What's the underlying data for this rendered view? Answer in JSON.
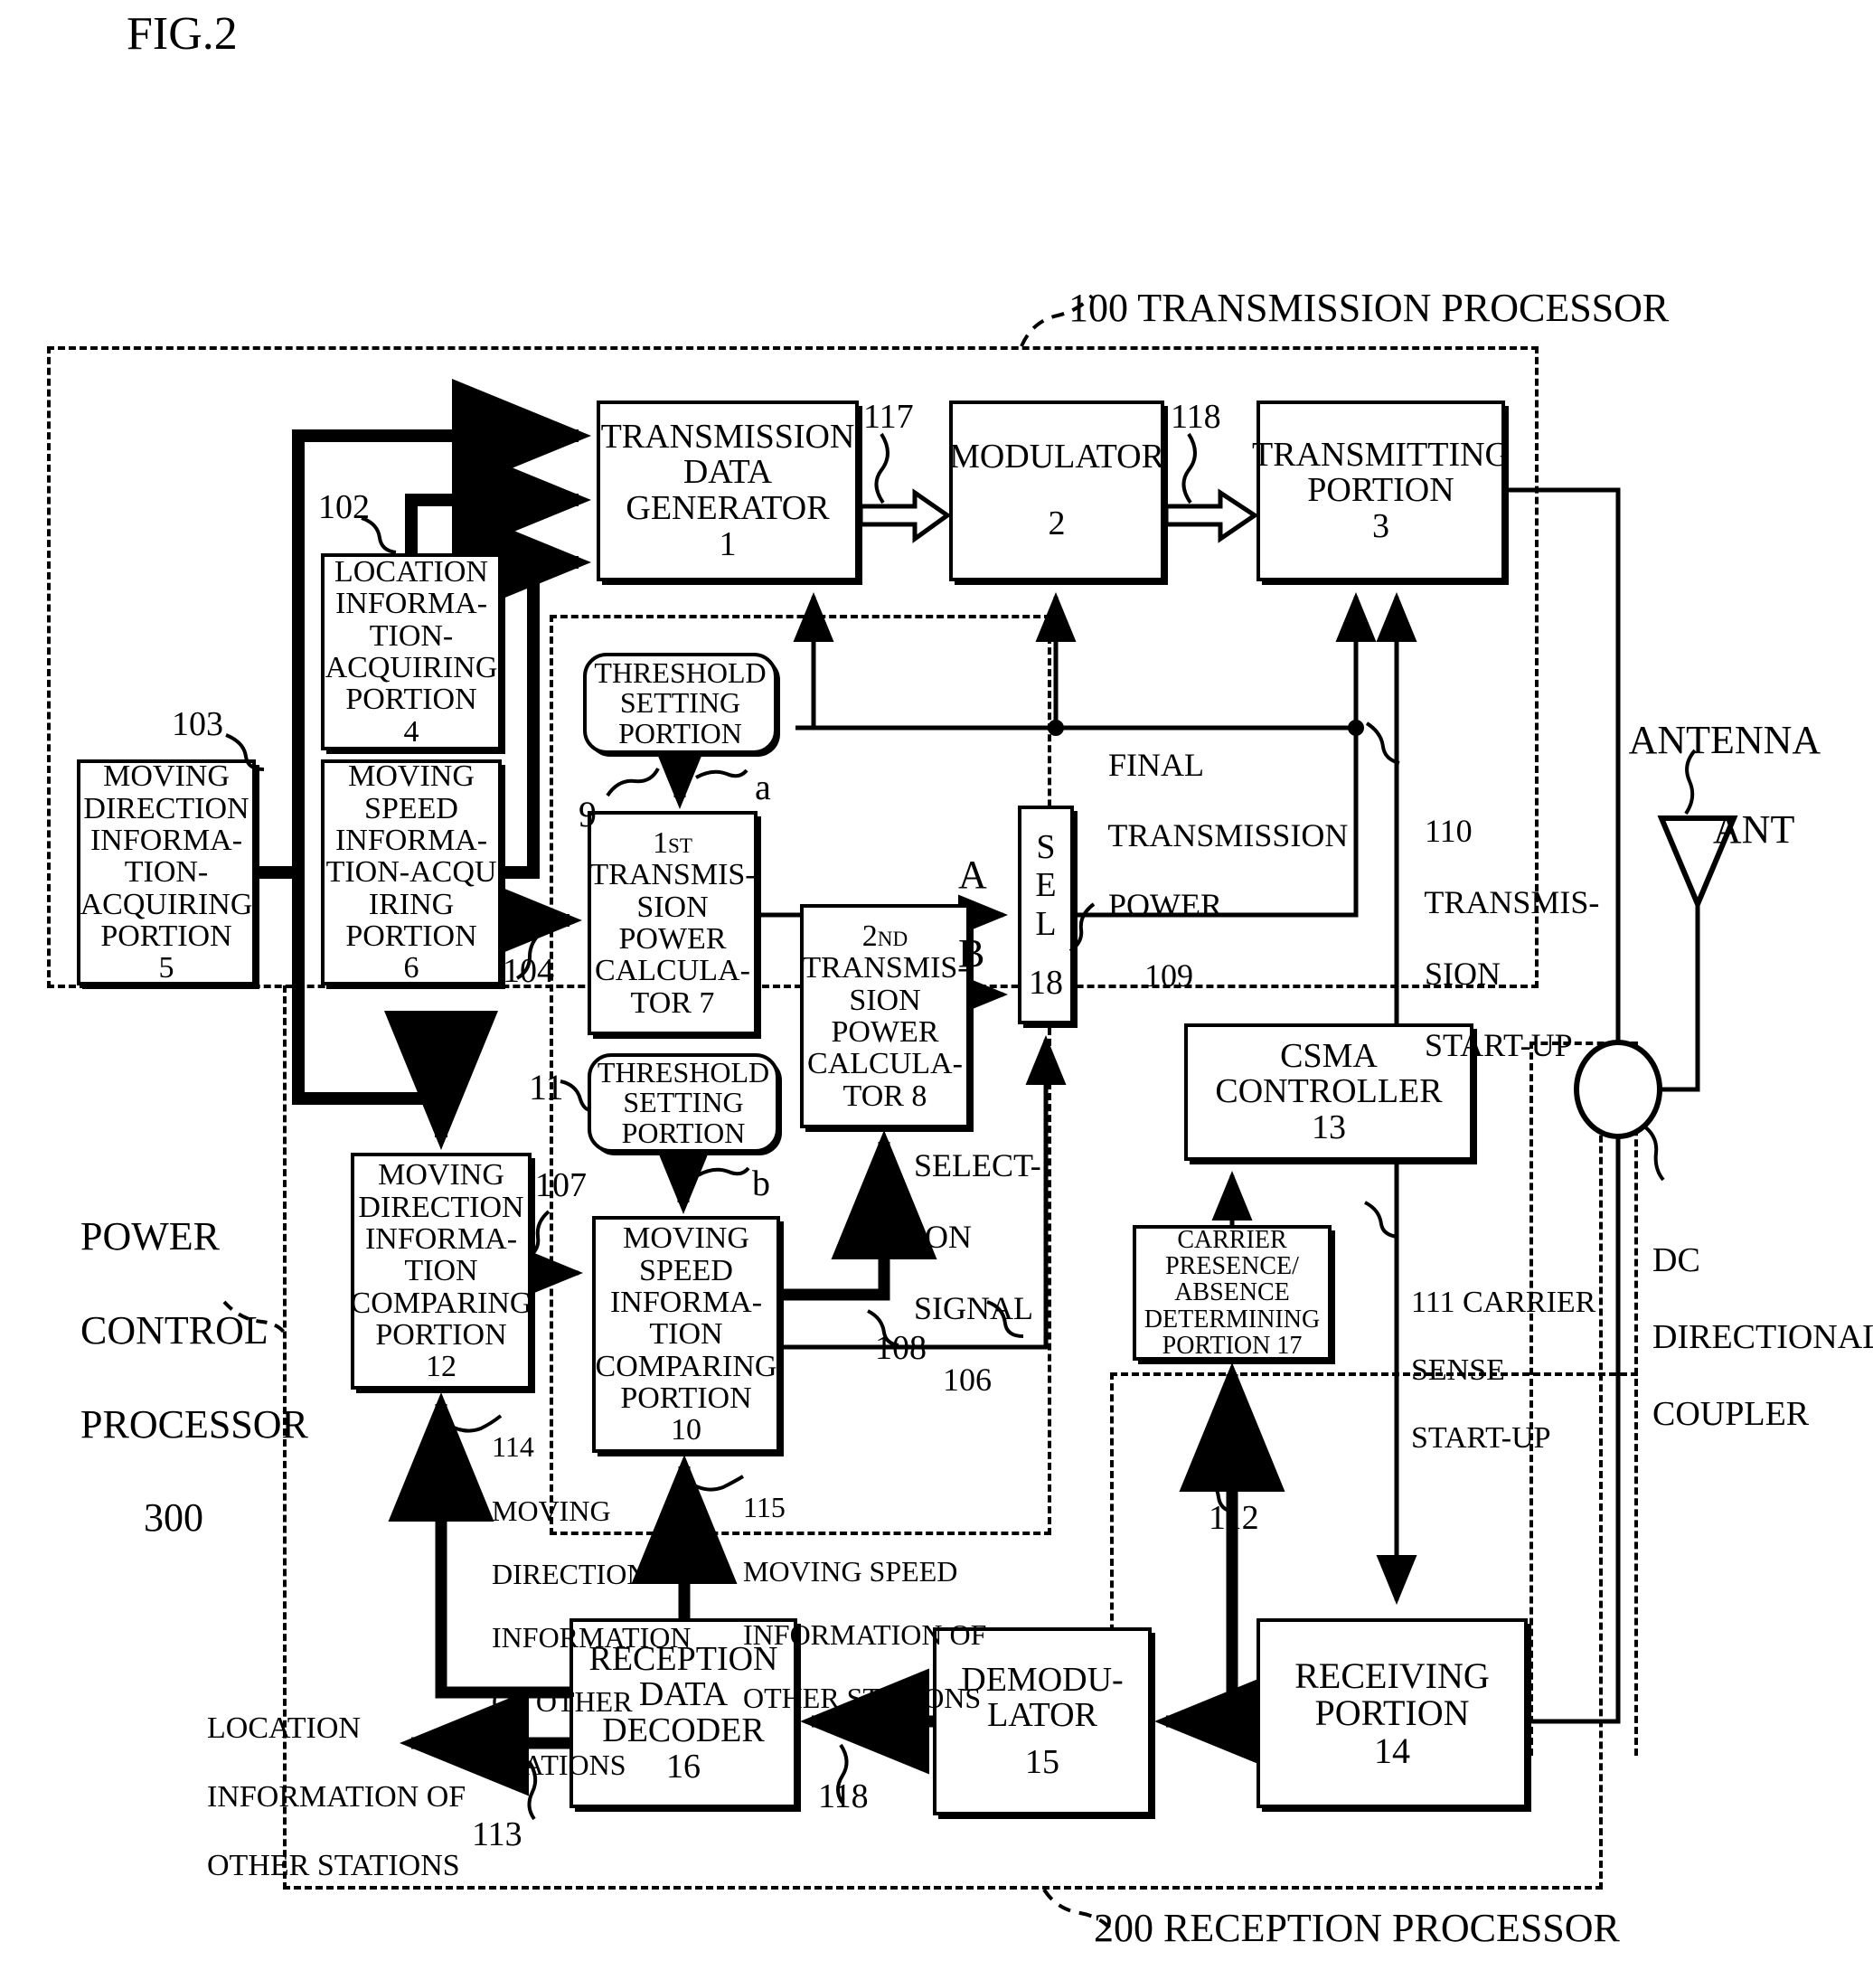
{
  "figure": {
    "title": "FIG.2"
  },
  "regions": {
    "transmission_processor": "100 TRANSMISSION PROCESSOR",
    "reception_processor": "200 RECEPTION PROCESSOR",
    "power_control_processor_l1": "POWER",
    "power_control_processor_l2": "CONTROL",
    "power_control_processor_l3": "PROCESSOR",
    "power_control_processor_num": "300"
  },
  "blocks": {
    "transmission_data_generator": {
      "l1": "TRANSMISSION",
      "l2": "DATA",
      "l3": "GENERATOR",
      "num": "1"
    },
    "modulator": {
      "l1": "MODULATOR",
      "num": "2"
    },
    "transmitting_portion": {
      "l1": "TRANSMITTING",
      "l2": "PORTION",
      "num": "3"
    },
    "location_info_acquiring": {
      "l1": "LOCATION",
      "l2": "INFORMA-",
      "l3": "TION-",
      "l4": "ACQUIRING",
      "l5": "PORTION",
      "num": "4"
    },
    "moving_direction_info_acquiring": {
      "l1": "MOVING",
      "l2": "DIRECTION",
      "l3": "INFORMA-",
      "l4": "TION-",
      "l5": "ACQUIRING",
      "l6": "PORTION",
      "num": "5"
    },
    "moving_speed_info_acquiring": {
      "l1": "MOVING",
      "l2": "SPEED",
      "l3": "INFORMA-",
      "l4": "TION-ACQU",
      "l5": "IRING",
      "l6": "PORTION",
      "num": "6"
    },
    "threshold_setting_a": {
      "l1": "THRESHOLD",
      "l2": "SETTING",
      "l3": "PORTION"
    },
    "threshold_setting_b": {
      "l1": "THRESHOLD",
      "l2": "SETTING",
      "l3": "PORTION"
    },
    "first_tx_power_calculator": {
      "l1": "1ST",
      "l2": "TRANSMIS-",
      "l3": "SION",
      "l4": "POWER",
      "l5": "CALCULA-",
      "l6": "TOR 7"
    },
    "second_tx_power_calculator": {
      "l1": "2ND",
      "l2": "TRANSMIS-",
      "l3": "SION",
      "l4": "POWER",
      "l5": "CALCULA-",
      "l6": "TOR 8"
    },
    "selector": {
      "l1": "S",
      "l2": "E",
      "l3": "L",
      "num": "18"
    },
    "csma_controller": {
      "l1": "CSMA",
      "l2": "CONTROLLER",
      "num": "13"
    },
    "carrier_presence_absence": {
      "l1": "CARRIER",
      "l2": "PRESENCE/",
      "l3": "ABSENCE",
      "l4": "DETERMINING",
      "l5": "PORTION 17"
    },
    "moving_direction_comparing": {
      "l1": "MOVING",
      "l2": "DIRECTION",
      "l3": "INFORMA-",
      "l4": "TION",
      "l5": "COMPARING",
      "l6": "PORTION",
      "num": "12"
    },
    "moving_speed_comparing": {
      "l1": "MOVING",
      "l2": "SPEED",
      "l3": "INFORMA-",
      "l4": "TION",
      "l5": "COMPARING",
      "l6": "PORTION",
      "num": "10"
    },
    "reception_data_decoder": {
      "l1": "RECEPTION",
      "l2": "DATA",
      "l3": "DECODER",
      "num": "16"
    },
    "demodulator": {
      "l1": "DEMODU-",
      "l2": "LATOR",
      "num": "15"
    },
    "receiving_portion": {
      "l1": "RECEIVING",
      "l2": "PORTION",
      "num": "14"
    }
  },
  "signal_labels": {
    "s102": "102",
    "s103": "103",
    "s104": "104",
    "s106_l1": "SELECT-",
    "s106_l2": "ION",
    "s106_l3": "SIGNAL",
    "s106_num": "106",
    "s107": "107",
    "s108": "108",
    "s109_l1": "FINAL",
    "s109_l2": "TRANSMISSION",
    "s109_l3": "POWER",
    "s109_num": "109",
    "s110_num": "110",
    "s110_l1": "TRANSMIS-",
    "s110_l2": "SION",
    "s110_l3": "START-UP",
    "s111_num": "111",
    "s111_l1": "CARRIER",
    "s111_l2": "SENSE",
    "s111_l3": "START-UP",
    "s112": "112",
    "s113": "113",
    "s114_num": "114",
    "s114_l1": "MOVING",
    "s114_l2": "DIRECTION",
    "s114_l3": "INFORMATION",
    "s114_l4": "OF OTHER",
    "s114_l5": "STATIONS",
    "s115_num": "115",
    "s115_l1": "MOVING SPEED",
    "s115_l2": "INFORMATION OF",
    "s115_l3": "OTHER STATIONS",
    "s117": "117",
    "s118_top": "118",
    "s118_bottom": "118",
    "threshold_a_num": "9",
    "threshold_a_letter": "a",
    "threshold_b_num": "11",
    "threshold_b_letter": "b",
    "sel_in_a": "A",
    "sel_in_b": "B",
    "location_info_other_l1": "LOCATION",
    "location_info_other_l2": "INFORMATION OF",
    "location_info_other_l3": "OTHER STATIONS",
    "antenna_l1": "ANTENNA",
    "antenna_l2": "ANT",
    "coupler_l1": "DC",
    "coupler_l2": "DIRECTIONAL",
    "coupler_l3": "COUPLER"
  },
  "colors": {
    "ink": "#000000",
    "paper": "#ffffff"
  }
}
